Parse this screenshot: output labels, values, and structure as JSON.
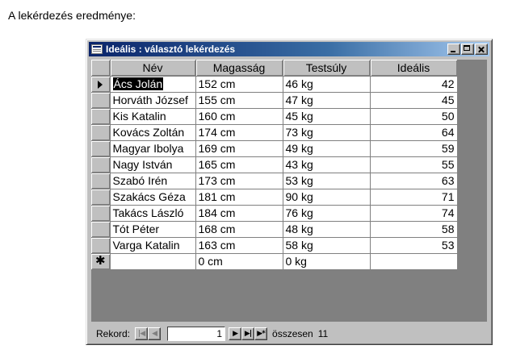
{
  "caption": "A lekérdezés eredménye:",
  "window": {
    "title": "Ideális : választó lekérdezés"
  },
  "columns": [
    "Név",
    "Magasság",
    "Testsúly",
    "Ideális"
  ],
  "rows": [
    {
      "name": "Ács Jolán",
      "height": "152 cm",
      "weight": "46 kg",
      "ideal": "42"
    },
    {
      "name": "Horváth József",
      "height": "155 cm",
      "weight": "47 kg",
      "ideal": "45"
    },
    {
      "name": "Kis Katalin",
      "height": "160 cm",
      "weight": "45 kg",
      "ideal": "50"
    },
    {
      "name": "Kovács Zoltán",
      "height": "174 cm",
      "weight": "73 kg",
      "ideal": "64"
    },
    {
      "name": "Magyar Ibolya",
      "height": "169 cm",
      "weight": "49 kg",
      "ideal": "59"
    },
    {
      "name": "Nagy István",
      "height": "165 cm",
      "weight": "43 kg",
      "ideal": "55"
    },
    {
      "name": "Szabó Irén",
      "height": "173 cm",
      "weight": "53 kg",
      "ideal": "63"
    },
    {
      "name": "Szakács Géza",
      "height": "181 cm",
      "weight": "90 kg",
      "ideal": "71"
    },
    {
      "name": "Takács László",
      "height": "184 cm",
      "weight": "76 kg",
      "ideal": "74"
    },
    {
      "name": "Tót Péter",
      "height": "168 cm",
      "weight": "48 kg",
      "ideal": "58"
    },
    {
      "name": "Varga Katalin",
      "height": "163 cm",
      "weight": "58 kg",
      "ideal": "53"
    }
  ],
  "new_row": {
    "height": "0 cm",
    "weight": "0 kg"
  },
  "navigation": {
    "label": "Rekord:",
    "current": "1",
    "total_label": "összesen",
    "total": "11",
    "first_icon": "first-record-icon",
    "prev_icon": "previous-record-icon",
    "next_icon": "next-record-icon",
    "last_icon": "last-record-icon",
    "new_icon": "new-record-icon"
  }
}
